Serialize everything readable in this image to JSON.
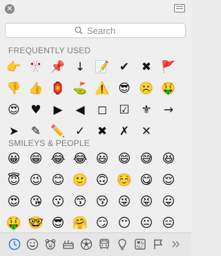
{
  "window": {
    "close_label": "✕"
  },
  "search": {
    "placeholder": "Search"
  },
  "frequently_used": {
    "title": "FREQUENTLY USED",
    "items": [
      "👉",
      "🎌",
      "📌",
      "↓",
      "📝",
      "✔",
      "✖",
      "🚩",
      "👎",
      "👍",
      "🏮",
      "⛳",
      "⚠️",
      "😎",
      "☹️",
      "🤑",
      "😍",
      "♥",
      "▶",
      "◀",
      "◻",
      "☑",
      "⚜",
      "→",
      "➤",
      "✎",
      "✏️",
      "✓",
      "✖",
      "✗",
      "✕",
      ""
    ]
  },
  "smileys": {
    "title": "SMILEYS & PEOPLE",
    "items": [
      "😀",
      "😁",
      "😂",
      "😂",
      "😃",
      "😄",
      "😅",
      "😆",
      "😇",
      "😉",
      "😊",
      "🙂",
      "🙃",
      "☺️",
      "😋",
      "😌",
      "😍",
      "😘",
      "😗",
      "😙",
      "😚",
      "😜",
      "😝",
      "😛",
      "🤑",
      "🤓",
      "😎",
      "🤗",
      "😏",
      "😶",
      "😐",
      "😑",
      "😒",
      "🙄",
      "🤔",
      "😳",
      "😞",
      "😟",
      "😠",
      "😡"
    ]
  },
  "toolbar": {
    "tabs": [
      "clock-icon",
      "smiley-icon",
      "bear-icon",
      "food-icon",
      "ball-icon",
      "car-icon",
      "bulb-icon",
      "symbols-icon",
      "flag-icon",
      "more-icon"
    ],
    "selected": "clock-icon",
    "accent": "#2f7fe0"
  }
}
